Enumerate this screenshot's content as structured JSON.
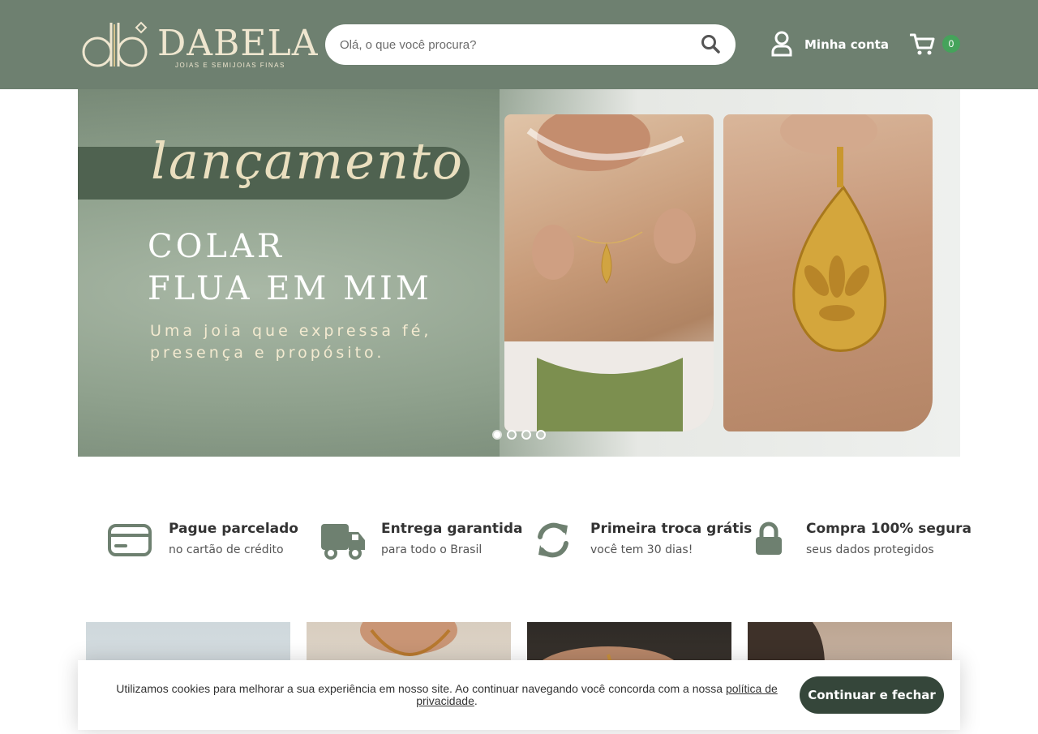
{
  "header": {
    "logo_monogram": "db",
    "brand": "DABELA",
    "tagline": "JOIAS E SEMIJOIAS FINAS",
    "search_placeholder": "Olá, o que você procura?",
    "account_label": "Minha conta",
    "cart_count": "0",
    "background_color": "#6e8070"
  },
  "banner": {
    "script_title": "lançamento",
    "headline_line1": "COLAR",
    "headline_line2": "FLUA EM MIM",
    "subtitle_line1": "Uma joia que expressa fé,",
    "subtitle_line2": "presença e propósito.",
    "slide_count": 4,
    "active_slide": 1
  },
  "features": [
    {
      "icon": "credit-card-icon",
      "title": "Pague parcelado",
      "desc": "no cartão de crédito"
    },
    {
      "icon": "truck-icon",
      "title": "Entrega garantida",
      "desc": "para todo o Brasil"
    },
    {
      "icon": "refresh-icon",
      "title": "Primeira troca grátis",
      "desc": "você tem 30 dias!"
    },
    {
      "icon": "lock-icon",
      "title": "Compra 100% segura",
      "desc": "seus dados protegidos"
    }
  ],
  "cookie": {
    "text": "Utilizamos cookies para melhorar a sua experiência em nosso site. Ao continuar navegando você concorda com a nossa ",
    "link_text": "política de privacidade",
    "suffix": ".",
    "button_label": "Continuar e fechar"
  },
  "colors": {
    "accent_dark": "#35463a",
    "icon_color": "#6e8070",
    "badge": "#45a35b"
  }
}
